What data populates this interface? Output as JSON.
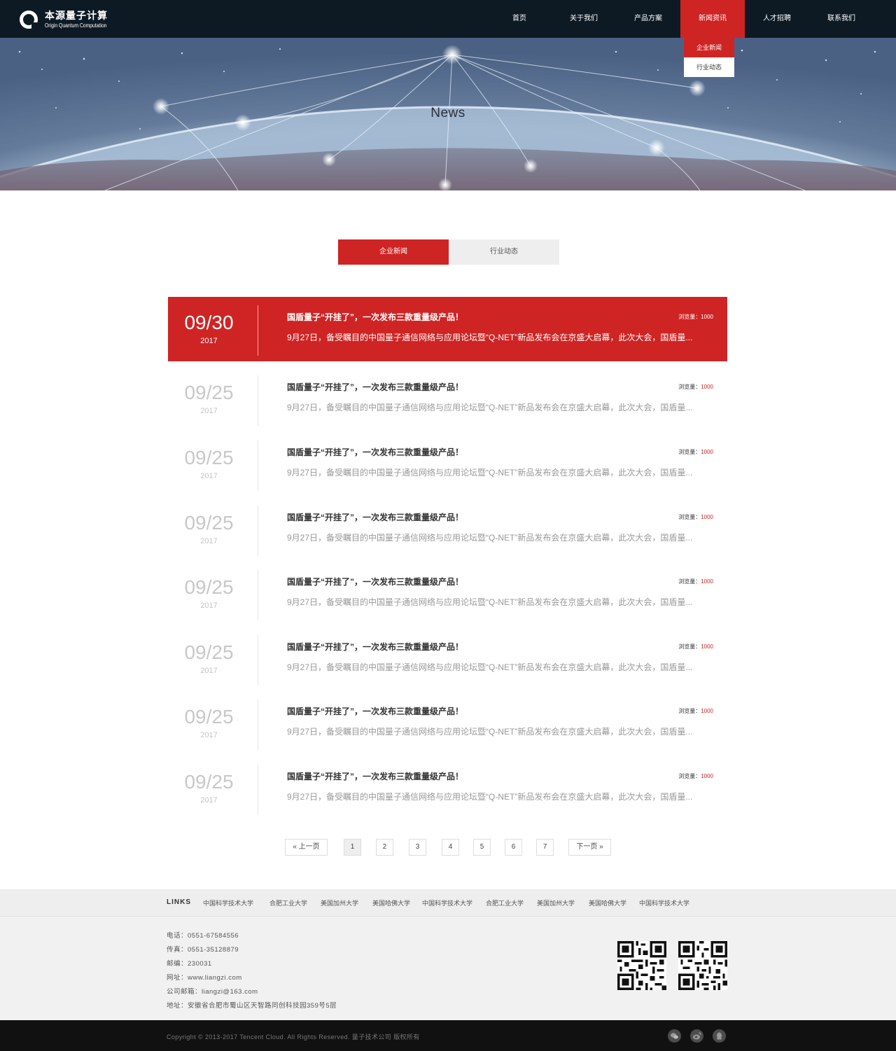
{
  "brand": {
    "name_cn": "本源量子计算",
    "name_en": "Origin Quantum Computation"
  },
  "nav": [
    {
      "label": "首页"
    },
    {
      "label": "关于我们"
    },
    {
      "label": "产品方案"
    },
    {
      "label": "新闻资讯",
      "active": true
    },
    {
      "label": "人才招聘"
    },
    {
      "label": "联系我们"
    }
  ],
  "nav_dropdown": [
    {
      "label": "企业新闻",
      "active": true
    },
    {
      "label": "行业动态"
    }
  ],
  "banner": {
    "title": "News"
  },
  "tabs": [
    {
      "label": "企业新闻",
      "active": true
    },
    {
      "label": "行业动态"
    }
  ],
  "news": [
    {
      "day": "09/30",
      "year": "2017",
      "title": "国盾量子“开挂了”，一次发布三款重量级产品！",
      "summary": "9月27日，备受瞩目的中国量子通信网络与应用论坛暨“Q-NET”新品发布会在京盛大启幕，此次大会，国盾量...",
      "views_label": "浏览量：",
      "views": "1000",
      "featured": true
    },
    {
      "day": "09/25",
      "year": "2017",
      "title": "国盾量子“开挂了”，一次发布三款重量级产品！",
      "summary": "9月27日，备受瞩目的中国量子通信网络与应用论坛暨“Q-NET”新品发布会在京盛大启幕，此次大会，国盾量...",
      "views_label": "浏览量：",
      "views": "1000"
    },
    {
      "day": "09/25",
      "year": "2017",
      "title": "国盾量子“开挂了”，一次发布三款重量级产品！",
      "summary": "9月27日，备受瞩目的中国量子通信网络与应用论坛暨“Q-NET”新品发布会在京盛大启幕，此次大会，国盾量...",
      "views_label": "浏览量：",
      "views": "1000"
    },
    {
      "day": "09/25",
      "year": "2017",
      "title": "国盾量子“开挂了”，一次发布三款重量级产品！",
      "summary": "9月27日，备受瞩目的中国量子通信网络与应用论坛暨“Q-NET”新品发布会在京盛大启幕，此次大会，国盾量...",
      "views_label": "浏览量：",
      "views": "1000"
    },
    {
      "day": "09/25",
      "year": "2017",
      "title": "国盾量子“开挂了”，一次发布三款重量级产品！",
      "summary": "9月27日，备受瞩目的中国量子通信网络与应用论坛暨“Q-NET”新品发布会在京盛大启幕，此次大会，国盾量...",
      "views_label": "浏览量：",
      "views": "1000"
    },
    {
      "day": "09/25",
      "year": "2017",
      "title": "国盾量子“开挂了”，一次发布三款重量级产品！",
      "summary": "9月27日，备受瞩目的中国量子通信网络与应用论坛暨“Q-NET”新品发布会在京盛大启幕，此次大会，国盾量...",
      "views_label": "浏览量：",
      "views": "1000"
    },
    {
      "day": "09/25",
      "year": "2017",
      "title": "国盾量子“开挂了”，一次发布三款重量级产品！",
      "summary": "9月27日，备受瞩目的中国量子通信网络与应用论坛暨“Q-NET”新品发布会在京盛大启幕，此次大会，国盾量...",
      "views_label": "浏览量：",
      "views": "1000"
    },
    {
      "day": "09/25",
      "year": "2017",
      "title": "国盾量子“开挂了”，一次发布三款重量级产品！",
      "summary": "9月27日，备受瞩目的中国量子通信网络与应用论坛暨“Q-NET”新品发布会在京盛大启幕，此次大会，国盾量...",
      "views_label": "浏览量：",
      "views": "1000"
    }
  ],
  "pagination": {
    "prev": "上一页",
    "next": "下一页",
    "pages": [
      "1",
      "2",
      "3",
      "4",
      "5",
      "6",
      "7"
    ],
    "current": "1"
  },
  "links": {
    "label": "LINKS",
    "items": [
      "中国科学技术大学",
      "合肥工业大学",
      "美国加州大学",
      "美国哈佛大学",
      "中国科学技术大学",
      "合肥工业大学",
      "美国加州大学",
      "美国哈佛大学",
      "中国科学技术大学"
    ]
  },
  "contact": [
    "电话：0551-67584556",
    "传真：0551-35128879",
    "邮编：230031",
    "网址：www.liangzi.com",
    "公司邮箱：liangzi@163.com",
    "地址：安徽省合肥市蜀山区天智路同创科技园359号5层"
  ],
  "footer": {
    "copyright": "Copyright © 2013-2017 Tencent Cloud. All Rights Reserved. 量子技术公司 版权所有",
    "social_icons": [
      "wechat-icon",
      "weibo-icon",
      "qq-icon"
    ]
  },
  "colors": {
    "accent": "#cf2424",
    "header_bg": "#0d1a24",
    "footer_bg": "#111111"
  }
}
